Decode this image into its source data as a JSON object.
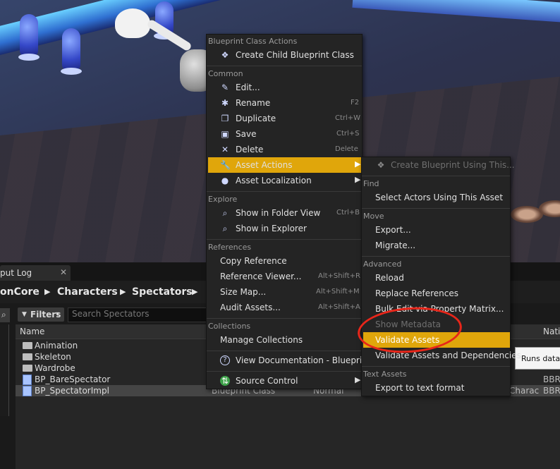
{
  "tabs": {
    "output_log": "put Log",
    "close": "✕"
  },
  "breadcrumb": {
    "items": [
      "onCore",
      "Characters",
      "Spectators"
    ],
    "sep": "▶"
  },
  "toolbar": {
    "filters": "Filters",
    "filters_icon": "▼",
    "filters_chevron": "▾",
    "search_placeholder": "Search Spectators",
    "search_icon": "⌕"
  },
  "columns": {
    "name": "Name",
    "native": "Nativ"
  },
  "assets": [
    {
      "label": "Animation",
      "kind": "folder"
    },
    {
      "label": "Skeleton",
      "kind": "folder"
    },
    {
      "label": "Wardrobe",
      "kind": "folder"
    },
    {
      "label": "BP_BareSpectator",
      "kind": "blueprint",
      "native": "BBR"
    },
    {
      "label": "BP_SpectatorImpl",
      "kind": "blueprint",
      "type": "Blueprint Class",
      "mode": "Normal",
      "parent": "Charac",
      "native": "BBR"
    }
  ],
  "tooltip": "Runs data v",
  "context_menu": {
    "sections": {
      "blueprint": "Blueprint Class Actions",
      "common": "Common",
      "explore": "Explore",
      "references": "References",
      "collections": "Collections"
    },
    "items": {
      "create_child": {
        "label": "Create Child Blueprint Class",
        "icon": "❖"
      },
      "edit": {
        "label": "Edit...",
        "icon": "✎"
      },
      "rename": {
        "label": "Rename",
        "shortcut": "F2",
        "icon": "✱"
      },
      "duplicate": {
        "label": "Duplicate",
        "shortcut": "Ctrl+W",
        "icon": "❐"
      },
      "save": {
        "label": "Save",
        "shortcut": "Ctrl+S",
        "icon": "▣"
      },
      "delete": {
        "label": "Delete",
        "shortcut": "Delete",
        "icon": "✕"
      },
      "asset_actions": {
        "label": "Asset Actions",
        "icon": "🔧"
      },
      "asset_localization": {
        "label": "Asset Localization",
        "icon": "●"
      },
      "show_folder": {
        "label": "Show in Folder View",
        "shortcut": "Ctrl+B",
        "icon": "⌕"
      },
      "show_explorer": {
        "label": "Show in Explorer",
        "icon": "⌕"
      },
      "copy_reference": {
        "label": "Copy Reference"
      },
      "reference_viewer": {
        "label": "Reference Viewer...",
        "shortcut": "Alt+Shift+R"
      },
      "size_map": {
        "label": "Size Map...",
        "shortcut": "Alt+Shift+M"
      },
      "audit_assets": {
        "label": "Audit Assets...",
        "shortcut": "Alt+Shift+A"
      },
      "manage_collections": {
        "label": "Manage Collections"
      },
      "view_docs": {
        "label": "View Documentation - Blueprint",
        "icon": "?"
      },
      "source_control": {
        "label": "Source Control",
        "icon": "⇅"
      }
    },
    "arrow": "▶"
  },
  "submenu": {
    "sections": {
      "find": "Find",
      "move": "Move",
      "advanced": "Advanced",
      "text_assets": "Text Assets"
    },
    "items": {
      "create_bp": {
        "label": "Create Blueprint Using This...",
        "icon": "❖"
      },
      "select_actors": "Select Actors Using This Asset",
      "export": "Export...",
      "migrate": "Migrate...",
      "reload": "Reload",
      "replace_refs": "Replace References",
      "bulk_edit": "Bulk Edit via Property Matrix...",
      "show_metadata": "Show Metadata",
      "validate_assets": "Validate Assets",
      "validate_deps": "Validate Assets and Dependencies",
      "export_text": "Export to text format"
    }
  },
  "colors": {
    "highlight": "#e0a60b",
    "annotation": "#e8261a"
  }
}
